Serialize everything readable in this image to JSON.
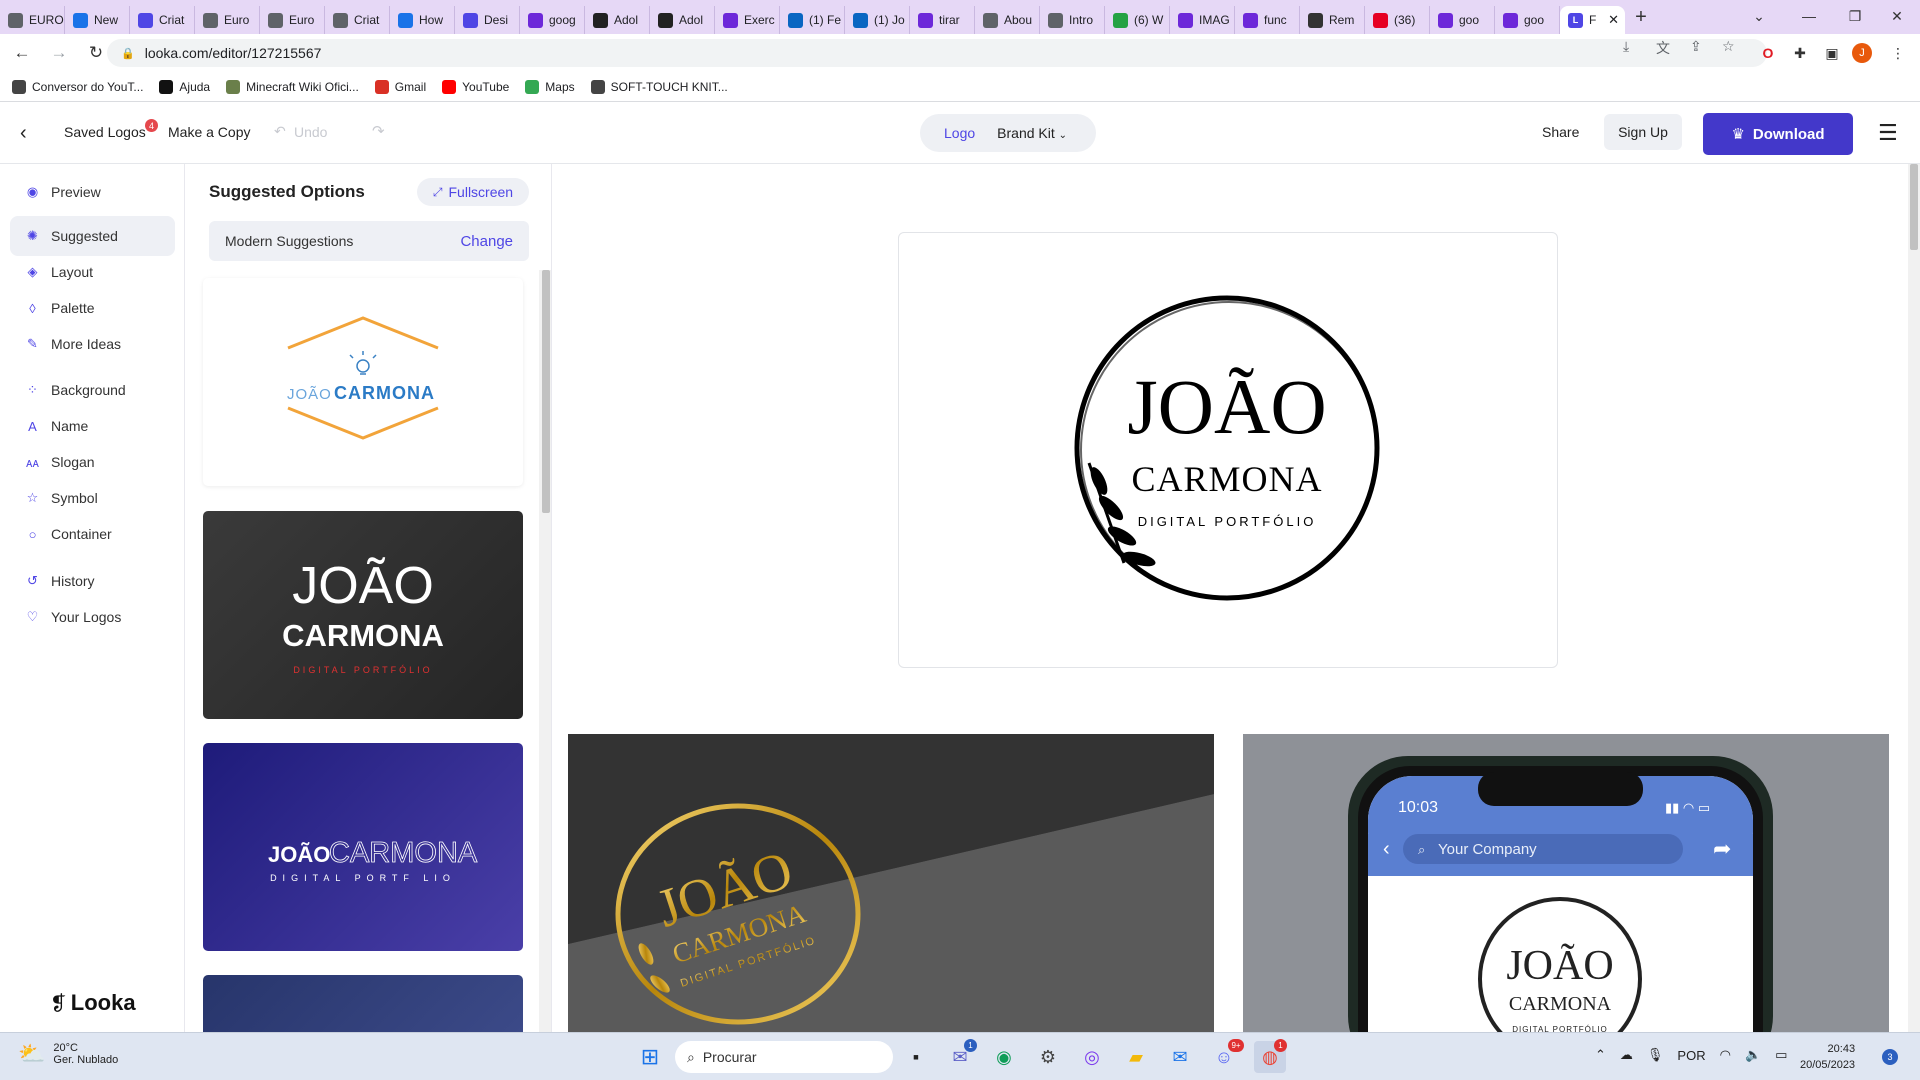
{
  "browser": {
    "tabs": [
      {
        "label": "EURO",
        "color": "#5f6368"
      },
      {
        "label": "New",
        "color": "#1a73e8"
      },
      {
        "label": "Criat",
        "color": "#4f46e5"
      },
      {
        "label": "Euro",
        "color": "#5f6368"
      },
      {
        "label": "Euro",
        "color": "#5f6368"
      },
      {
        "label": "Criat",
        "color": "#5f6368"
      },
      {
        "label": "How",
        "color": "#1a73e8"
      },
      {
        "label": "Desi",
        "color": "#4f46e5"
      },
      {
        "label": "goog",
        "color": "#6d28d9"
      },
      {
        "label": "Adol",
        "color": "#222222"
      },
      {
        "label": "Adol",
        "color": "#222222"
      },
      {
        "label": "Exerc",
        "color": "#6d28d9"
      },
      {
        "label": "(1) Fe",
        "color": "#0a66c2"
      },
      {
        "label": "(1) Jo",
        "color": "#0a66c2"
      },
      {
        "label": "tirar",
        "color": "#6d28d9"
      },
      {
        "label": "Abou",
        "color": "#5f6368"
      },
      {
        "label": "Intro",
        "color": "#5f6368"
      },
      {
        "label": "(6) W",
        "color": "#25a244"
      },
      {
        "label": "IMAG",
        "color": "#6d28d9"
      },
      {
        "label": "func",
        "color": "#6d28d9"
      },
      {
        "label": "Rem",
        "color": "#333333"
      },
      {
        "label": "(36)",
        "color": "#e60023"
      },
      {
        "label": "goo",
        "color": "#6d28d9"
      },
      {
        "label": "goo",
        "color": "#6d28d9"
      }
    ],
    "active_tab": {
      "label": "F",
      "color": "#4f46e5"
    },
    "url": "looka.com/editor/127215567",
    "bookmarks": [
      {
        "label": "Conversor do YouT...",
        "color": "#444444"
      },
      {
        "label": "Ajuda",
        "color": "#111111"
      },
      {
        "label": "Minecraft Wiki Ofici...",
        "color": "#6a7f4a"
      },
      {
        "label": "Gmail",
        "color": "#d93025"
      },
      {
        "label": "YouTube",
        "color": "#ff0000"
      },
      {
        "label": "Maps",
        "color": "#34a853"
      },
      {
        "label": "SOFT-TOUCH KNIT...",
        "color": "#444444"
      }
    ],
    "profile_initial": "J"
  },
  "header": {
    "saved_logos": "Saved Logos",
    "saved_badge": "4",
    "make_copy": "Make a Copy",
    "undo": "Undo",
    "seg_logo": "Logo",
    "seg_brandkit": "Brand Kit",
    "share": "Share",
    "sign_up": "Sign Up",
    "download": "Download",
    "accent": "#4338ca"
  },
  "nav": {
    "items": [
      {
        "label": "Preview",
        "icon": "eye-icon"
      },
      {
        "label": "Suggested",
        "icon": "bulb-icon"
      },
      {
        "label": "Layout",
        "icon": "layers-icon"
      },
      {
        "label": "Palette",
        "icon": "drop-icon"
      },
      {
        "label": "More Ideas",
        "icon": "pin-icon"
      },
      {
        "label": "Background",
        "icon": "grid-icon"
      },
      {
        "label": "Name",
        "icon": "text-icon"
      },
      {
        "label": "Slogan",
        "icon": "slogan-icon"
      },
      {
        "label": "Symbol",
        "icon": "star-icon"
      },
      {
        "label": "Container",
        "icon": "circle-icon"
      },
      {
        "label": "History",
        "icon": "history-icon"
      },
      {
        "label": "Your Logos",
        "icon": "heart-icon"
      }
    ],
    "brand": "Looka"
  },
  "suggestions": {
    "title": "Suggested Options",
    "fullscreen": "Fullscreen",
    "mode": "Modern Suggestions",
    "change": "Change",
    "cards": [
      {
        "first": "JOÃO",
        "last": "CARMONA",
        "tagline": ""
      },
      {
        "first": "JOÃO",
        "last": "CARMONA",
        "tagline": "DIGITAL PORTFÓLIO"
      },
      {
        "first": "JOÃO",
        "last": "CARMONA",
        "tagline": "DIGITAL PORTF LIO"
      }
    ]
  },
  "logo": {
    "first": "JOÃO",
    "last": "CARMONA",
    "tagline": "DIGITAL PORTFÓLIO"
  },
  "mockups": {
    "phone_time": "10:03",
    "phone_search": "Your Company"
  },
  "taskbar": {
    "temp": "20°C",
    "weather": "Ger. Nublado",
    "search": "Procurar",
    "lang": "POR",
    "time": "20:43",
    "date": "20/05/2023",
    "notifications": "3",
    "chat_badge": "1",
    "discord_badge": "9+",
    "chrome_badge": "1"
  }
}
